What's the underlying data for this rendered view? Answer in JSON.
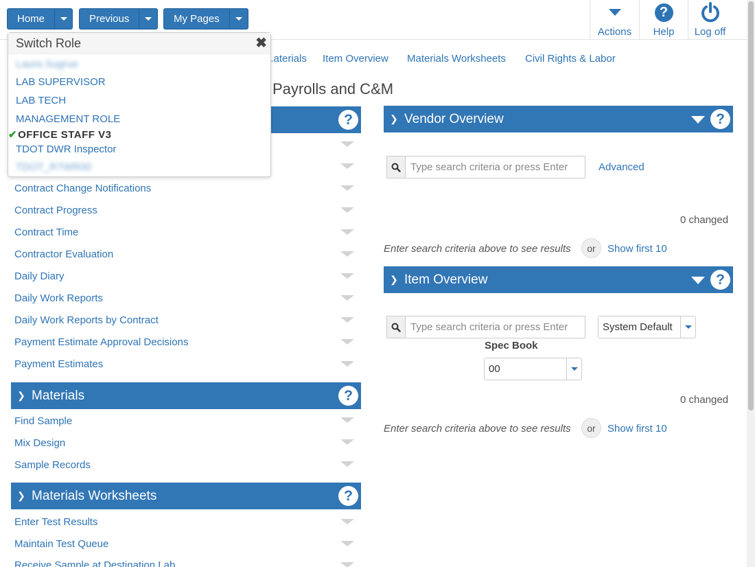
{
  "nav": {
    "home": "Home",
    "previous": "Previous",
    "my_pages": "My Pages",
    "actions": "Actions",
    "help": "Help",
    "logoff": "Log off"
  },
  "tabs": [
    "...aterials",
    "Item Overview",
    "Materials Worksheets",
    "Civil Rights & Labor"
  ],
  "page_heading": "Payrolls and C&M",
  "switch_role": {
    "title": "Switch Role",
    "items": [
      {
        "label": "Laura Sugrue",
        "blurred": true
      },
      {
        "label": "LAB SUPERVISOR"
      },
      {
        "label": "LAB TECH"
      },
      {
        "label": "MANAGEMENT ROLE"
      },
      {
        "label": "OFFICE STAFF V3",
        "active": true
      },
      {
        "label": "TDOT DWR Inspector"
      },
      {
        "label": "TDOT_R7WR00",
        "blurred": true
      }
    ]
  },
  "left": {
    "hidden_rows": [
      "",
      ""
    ],
    "contract_links": [
      "Contract Change Notifications",
      "Contract Progress",
      "Contract Time",
      "Contractor Evaluation",
      "Daily Diary",
      "Daily Work Reports",
      "Daily Work Reports by Contract",
      "Payment Estimate Approval Decisions",
      "Payment Estimates"
    ],
    "materials_title": "Materials",
    "materials_links": [
      "Find Sample",
      "Mix Design",
      "Sample Records"
    ],
    "worksheets_title": "Materials Worksheets",
    "worksheets_links": [
      "Enter Test Results",
      "Maintain Test Queue",
      "Receive Sample at Destination Lab"
    ]
  },
  "vendor": {
    "title": "Vendor Overview",
    "search_placeholder": "Type search criteria or press Enter",
    "advanced": "Advanced",
    "changed": "0 changed",
    "hint": "Enter search criteria above to see results",
    "or": "or",
    "show_first": "Show first 10"
  },
  "item": {
    "title": "Item Overview",
    "search_placeholder": "Type search criteria or press Enter",
    "system_default": "System Default",
    "spec_book_label": "Spec Book",
    "spec_book_value": "00",
    "changed": "0 changed",
    "hint": "Enter search criteria above to see results",
    "or": "or",
    "show_first": "Show first 10"
  }
}
